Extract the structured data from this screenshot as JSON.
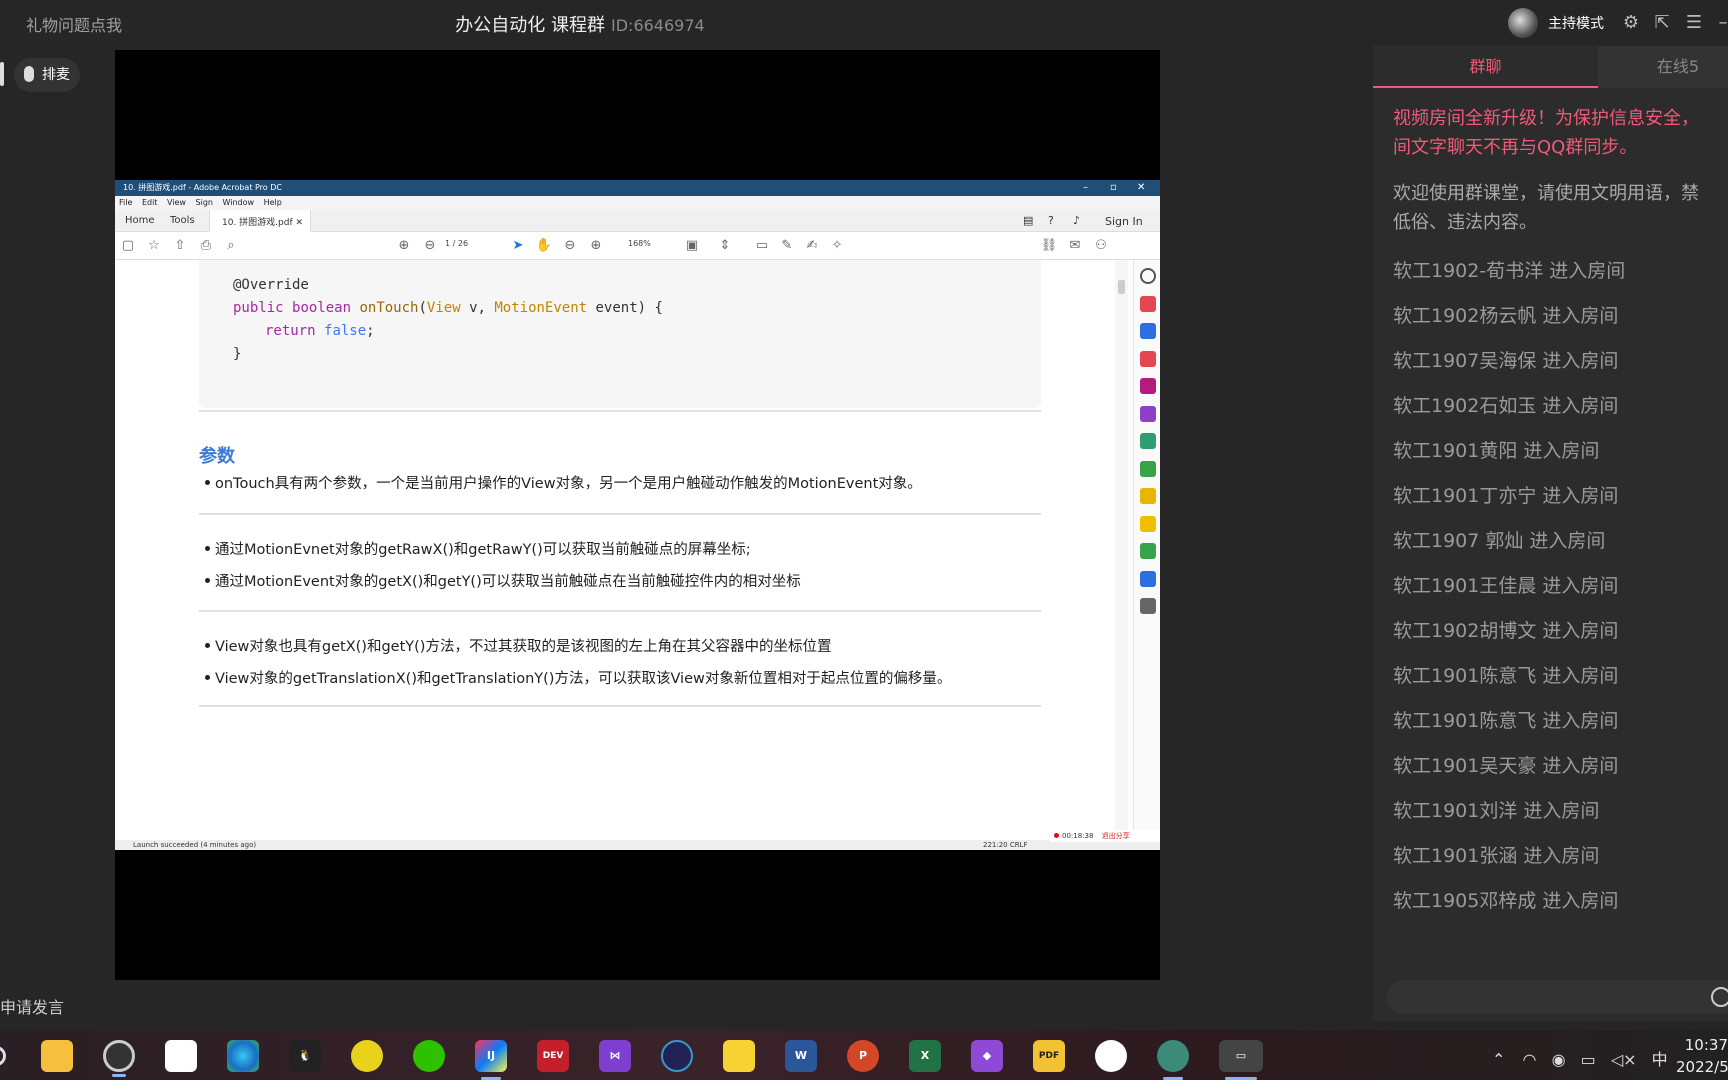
{
  "topbar": {
    "gift_link": "礼物问题点我",
    "room_name": "办公自动化 课程群",
    "room_id": "ID:6646974",
    "host_mode": "主持模式"
  },
  "left_panel": {
    "queue_button": "排麦",
    "apply_speak": "申请发言"
  },
  "acrobat": {
    "window_title": "10. 拼图游戏.pdf - Adobe Acrobat Pro DC",
    "menu": [
      "File",
      "Edit",
      "View",
      "Sign",
      "Window",
      "Help"
    ],
    "tabs": {
      "home": "Home",
      "tools": "Tools",
      "file": "10. 拼图游戏.pdf"
    },
    "sign_in": "Sign In",
    "page_current": "1",
    "page_total": "/ 26",
    "zoom": "168%",
    "code": {
      "line1": "@Override",
      "line2_kw1": "public",
      "line2_kw2": "boolean",
      "line2_fn": "onTouch",
      "line2_type1": "View",
      "line2_arg1": " v, ",
      "line2_type2": "MotionEvent",
      "line2_arg2": " event) {",
      "line3_kw": "return",
      "line3_val": "false",
      "line4": "}"
    },
    "section_title": "参数",
    "bullets": [
      "onTouch具有两个参数，一个是当前用户操作的View对象，另一个是用户触碰动作触发的MotionEvent对象。",
      "通过MotionEvnet对象的getRawX()和getRawY()可以获取当前触碰点的屏幕坐标;",
      "通过MotionEvent对象的getX()和getY()可以获取当前触碰点在当前触碰控件内的相对坐标",
      "View对象也具有getX()和getY()方法，不过其获取的是该视图的左上角在其父容器中的坐标位置",
      "View对象的getTranslationX()和getTranslationY()方法，可以获取该View对象新位置相对于起点位置的偏移量。"
    ],
    "status_left": "Launch succeeded (4 minutes ago)",
    "status_right": "221:20   CRLF",
    "rec_time": "00:18:38",
    "rec_exit": "退出分享"
  },
  "chat": {
    "tab_group": "群聊",
    "tab_online": "在线5",
    "notice_line1": "视频房间全新升级！为保护信息安全，",
    "notice_line2": "间文字聊天不再与QQ群同步。",
    "welcome_line1": "欢迎使用群课堂，请使用文明用语，禁",
    "welcome_line2": "低俗、违法内容。",
    "entries": [
      "软工1902-荀书洋 进入房间",
      "软工1902杨云帆 进入房间",
      "软工1907吴海保 进入房间",
      "软工1902石如玉 进入房间",
      "软工1901黄阳 进入房间",
      "软工1901丁亦宁 进入房间",
      "软工1907 郭灿 进入房间",
      "软工1901王佳晨 进入房间",
      "软工1902胡博文 进入房间",
      "软工1901陈意飞 进入房间",
      "软工1901陈意飞 进入房间",
      "软工1901吴天豪 进入房间",
      "软工1901刘洋 进入房间",
      "软工1901张涵 进入房间",
      "软工1905邓梓成 进入房间"
    ]
  },
  "taskbar": {
    "ime": "中",
    "time": "10:37",
    "date": "2022/5"
  },
  "colors": {
    "accent_pink": "#f05a78",
    "acrobat_titlebar": "#1f4e78",
    "section_blue": "#3a7bd5"
  }
}
